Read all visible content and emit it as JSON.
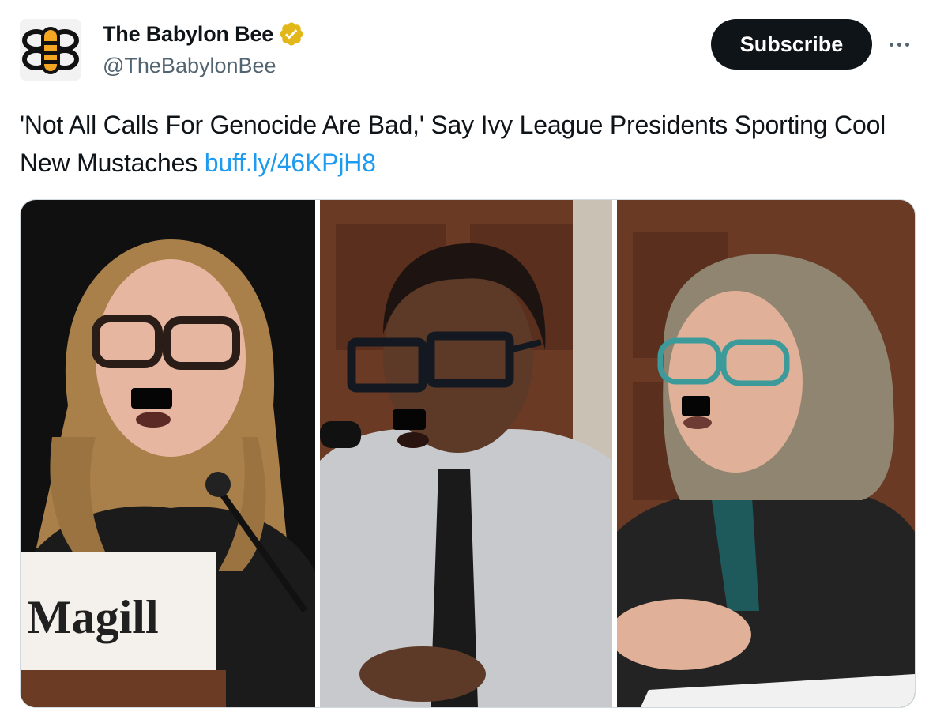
{
  "account": {
    "display_name": "The Babylon Bee",
    "handle": "@TheBabylonBee",
    "avatar_icon": "babylon-bee-logo-icon",
    "verified_icon": "verified-badge-icon",
    "verified_color": "#e2b719"
  },
  "actions": {
    "subscribe_label": "Subscribe",
    "more_icon": "more-options-icon"
  },
  "tweet": {
    "text": "'Not All Calls For Genocide Are Bad,' Say Ivy League Presidents Sporting Cool New Mustaches",
    "link": "buff.ly/46KPjH8",
    "link_color": "#1d9bf0"
  },
  "media": {
    "nameplate_text": "Magill"
  }
}
